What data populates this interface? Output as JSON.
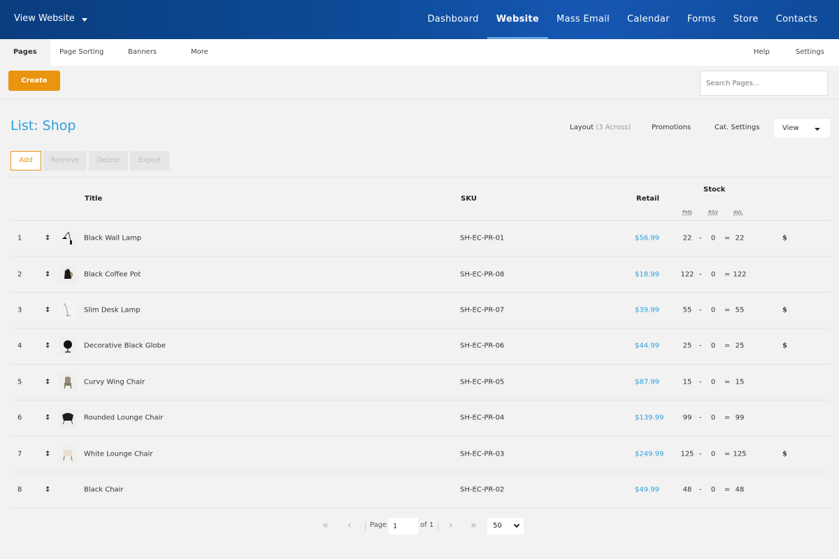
{
  "topbar": {
    "view_website": "View Website",
    "nav": [
      "Dashboard",
      "Website",
      "Mass Email",
      "Calendar",
      "Forms",
      "Store",
      "Contacts"
    ],
    "active_index": 1
  },
  "subnav": {
    "left": [
      "Pages",
      "Page Sorting",
      "Banners",
      "More"
    ],
    "right": [
      "Help",
      "Settings"
    ]
  },
  "toolbar": {
    "create_label": "Create",
    "search_placeholder": "Search Pages..."
  },
  "list": {
    "title": "List: Shop",
    "layout_label": "Layout",
    "layout_value": "(3 Across)",
    "promotions_label": "Promotions",
    "cat_settings_label": "Cat. Settings",
    "view_label": "View",
    "actions": {
      "add": "Add",
      "remove": "Remove",
      "delete": "Delete",
      "export": "Export"
    }
  },
  "table": {
    "headers": {
      "title": "Title",
      "sku": "SKU",
      "retail": "Retail",
      "stock": "Stock",
      "phs": "PHS",
      "rsv": "RSV",
      "avl": "AVL"
    },
    "dash": "-",
    "equals": "=",
    "rows": [
      {
        "num": "1",
        "title": "Black Wall Lamp",
        "sku": "SH-EC-PR-01",
        "price": "$56.99",
        "phs": "22",
        "rsv": "0",
        "avl": "22",
        "flag": "$"
      },
      {
        "num": "2",
        "title": "Black Coffee Pot",
        "sku": "SH-EC-PR-08",
        "price": "$18.99",
        "phs": "122",
        "rsv": "0",
        "avl": "122",
        "flag": ""
      },
      {
        "num": "3",
        "title": "Slim Desk Lamp",
        "sku": "SH-EC-PR-07",
        "price": "$39.99",
        "phs": "55",
        "rsv": "0",
        "avl": "55",
        "flag": "$"
      },
      {
        "num": "4",
        "title": "Decorative Black Globe",
        "sku": "SH-EC-PR-06",
        "price": "$44.99",
        "phs": "25",
        "rsv": "0",
        "avl": "25",
        "flag": "$"
      },
      {
        "num": "5",
        "title": "Curvy Wing Chair",
        "sku": "SH-EC-PR-05",
        "price": "$87.99",
        "phs": "15",
        "rsv": "0",
        "avl": "15",
        "flag": ""
      },
      {
        "num": "6",
        "title": "Rounded Lounge Chair",
        "sku": "SH-EC-PR-04",
        "price": "$139.99",
        "phs": "99",
        "rsv": "0",
        "avl": "99",
        "flag": ""
      },
      {
        "num": "7",
        "title": "White Lounge Chair",
        "sku": "SH-EC-PR-03",
        "price": "$249.99",
        "phs": "125",
        "rsv": "0",
        "avl": "125",
        "flag": "$"
      },
      {
        "num": "8",
        "title": "Black Chair",
        "sku": "SH-EC-PR-02",
        "price": "$49.99",
        "phs": "48",
        "rsv": "0",
        "avl": "48",
        "flag": ""
      }
    ]
  },
  "pagination": {
    "page_label": "Page",
    "page_value": "1",
    "of_label": "of 1",
    "page_size": "50"
  },
  "colors": {
    "accent": "#2d9fd9",
    "create": "#ea9410",
    "nav_bg": "#0d4c9a"
  }
}
